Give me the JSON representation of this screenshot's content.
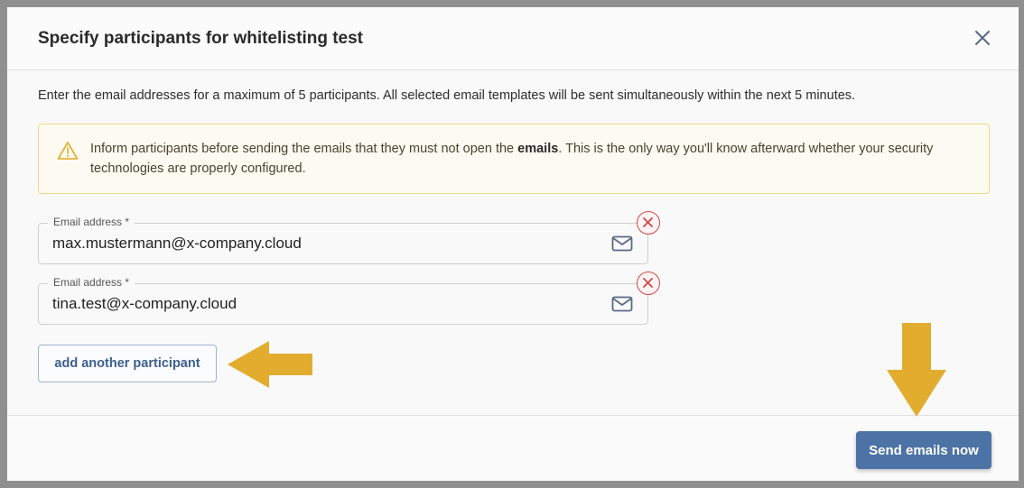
{
  "dialog": {
    "title": "Specify participants for whitelisting test",
    "close_icon": "close-icon"
  },
  "description": "Enter the email addresses for a maximum of 5 participants. All selected email templates will be sent simultaneously within the next 5 minutes.",
  "alert": {
    "icon": "warning-icon",
    "text_before": "Inform participants before sending the emails that they must not open the ",
    "text_bold": "emails",
    "text_after": ". This is the only way you'll know afterward whether your security technologies are properly configured."
  },
  "participants": [
    {
      "label": "Email address *",
      "value": "max.mustermann@x-company.cloud"
    },
    {
      "label": "Email address *",
      "value": "tina.test@x-company.cloud"
    }
  ],
  "add_button_label": "add another participant",
  "send_button_label": "Send emails now",
  "colors": {
    "primary": "#4d73a6",
    "annotation_arrow": "#e2ac2f",
    "alert_border": "#ecd984",
    "remove_red": "#d14848"
  }
}
